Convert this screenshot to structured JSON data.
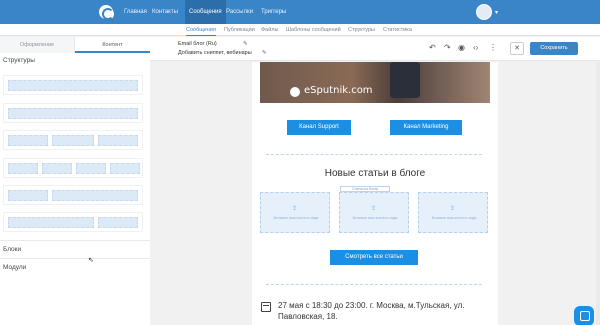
{
  "topnav": {
    "items": [
      "Главная",
      "Контакты",
      "Сообщения",
      "Рассылки",
      "Триггеры"
    ]
  },
  "subnav": {
    "items": [
      "Сообщения",
      "Публикации",
      "Файлы",
      "Шаблоны сообщений",
      "Структуры",
      "Статистика"
    ]
  },
  "editor": {
    "panel_tabs": [
      "Оформление",
      "Контент"
    ],
    "meta_line1": "Email блог (Ru)",
    "meta_line2": "Добавить сниппет, вебинары",
    "save_label": "Сохранить",
    "close_symbol": "✕"
  },
  "left_panel": {
    "structures_title": "Структуры",
    "blocks_label": "Блоки",
    "modules_label": "Модули"
  },
  "canvas": {
    "hero_brand": "eSputnik.com",
    "btn_support": "Канал Support",
    "btn_marketing": "Канал Marketing",
    "blog_title": "Новые статьи в блоге",
    "card_tag": "Статьи из блога",
    "card_caption": "Вставьте ваш контент сюда",
    "all_articles_btn": "Смотреть все статьи",
    "event_text": "27 мая с 18:30 до 23:00. г. Москва, м.Тульская, ул. Павловская, 18."
  }
}
